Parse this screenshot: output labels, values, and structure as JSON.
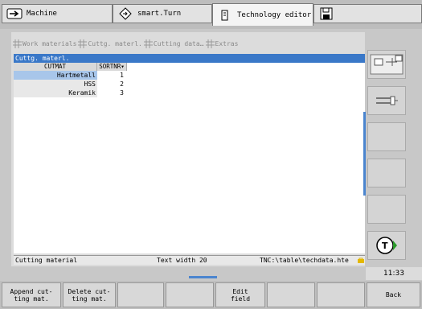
{
  "tabs": [
    {
      "label": "Machine",
      "icon": "arrow-icon",
      "active": false
    },
    {
      "label": "smart.Turn",
      "icon": "diamond-icon",
      "active": false
    },
    {
      "label": "Technology editor",
      "icon": "edit-icon",
      "active": true
    },
    {
      "label": "",
      "icon": "save-icon",
      "active": false
    }
  ],
  "toolbar": {
    "items": [
      "Work materials",
      "Cuttg. materl.",
      "Cutting data…",
      "Extras"
    ]
  },
  "table": {
    "title": "Cuttg. materl.",
    "columns": [
      "CUTMAT",
      "SORTNR▾"
    ],
    "rows": [
      {
        "cutmat": "Hartmetall",
        "sortnr": "1",
        "selected": true
      },
      {
        "cutmat": "HSS",
        "sortnr": "2",
        "selected": false
      },
      {
        "cutmat": "Keramik",
        "sortnr": "3",
        "selected": false
      }
    ]
  },
  "status": {
    "field": "Cutting material",
    "width": "Text width 20",
    "path": "TNC:\\table\\techdata.hte"
  },
  "clock": "11:33",
  "softkeys": [
    "Append cut-\nting mat.",
    "Delete cut-\nting mat.",
    "",
    "",
    "Edit\nfield",
    "",
    "",
    "",
    "Back"
  ],
  "colors": {
    "accent": "#3a78c8",
    "selection": "#a8c6ea"
  }
}
